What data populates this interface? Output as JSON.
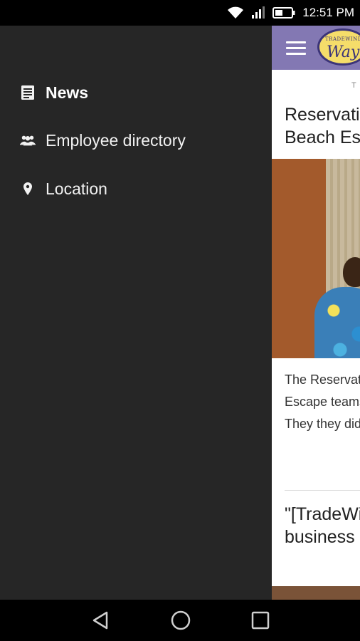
{
  "status_bar": {
    "time": "12:51 PM",
    "icons": [
      "wifi-icon",
      "signal-icon",
      "battery-icon"
    ]
  },
  "app": {
    "toolbar_color": "#8378b3",
    "logo_text_top": "TRADEWINDS",
    "logo_text": "Way",
    "article": {
      "kicker": "T",
      "title": "Reservations Beach Escape",
      "body": "The Reservations Beach Escape teams and game. They they did tell",
      "quote": "\"[TradeWinds to do business being the"
    }
  },
  "drawer": {
    "background": "#262626",
    "items": [
      {
        "label": "News",
        "icon": "news-icon",
        "active": true
      },
      {
        "label": "Employee directory",
        "icon": "people-icon",
        "active": false
      },
      {
        "label": "Location",
        "icon": "location-pin-icon",
        "active": false
      }
    ]
  },
  "nav_bar": {
    "buttons": [
      "back-icon",
      "home-icon",
      "recents-icon"
    ]
  }
}
